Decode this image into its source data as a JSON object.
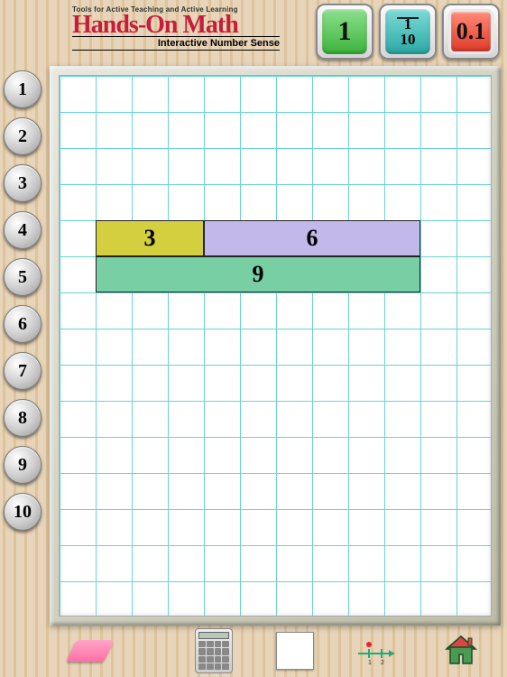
{
  "header": {
    "tagline": "Tools for Active Teaching and Active Learning",
    "title": "Hands-On Math",
    "subtitle": "Interactive Number Sense"
  },
  "modes": {
    "whole": "1",
    "fraction_num": "1",
    "fraction_den": "10",
    "decimal": "0.1"
  },
  "side_numbers": [
    "1",
    "2",
    "3",
    "4",
    "5",
    "6",
    "7",
    "8",
    "9",
    "10"
  ],
  "bars": [
    {
      "color": "yellow",
      "row": 4,
      "col": 1,
      "len": 3,
      "label": "3"
    },
    {
      "color": "purple",
      "row": 4,
      "col": 4,
      "len": 6,
      "label": "6"
    },
    {
      "color": "green",
      "row": 5,
      "col": 1,
      "len": 9,
      "label": "9"
    }
  ],
  "toolbar": {
    "eraser": "eraser",
    "blocks": "blocks",
    "calculator": "calculator",
    "clear": "clear",
    "numberline": "number-line",
    "home": "home"
  },
  "colors": {
    "brand": "#c41e3a",
    "grid": "#6ad3d3",
    "bar_yellow": "#d4cf3f",
    "bar_purple": "#c3b8ea",
    "bar_green": "#77cfa3"
  }
}
